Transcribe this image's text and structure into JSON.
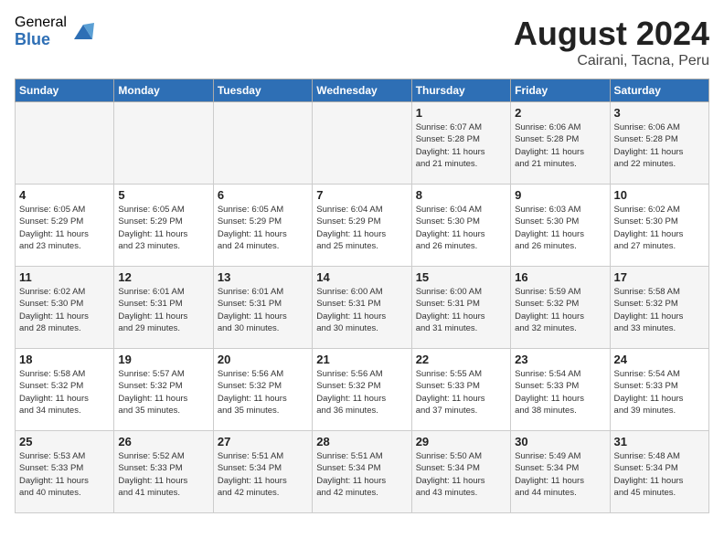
{
  "header": {
    "logo_general": "General",
    "logo_blue": "Blue",
    "month_title": "August 2024",
    "location": "Cairani, Tacna, Peru"
  },
  "weekdays": [
    "Sunday",
    "Monday",
    "Tuesday",
    "Wednesday",
    "Thursday",
    "Friday",
    "Saturday"
  ],
  "weeks": [
    [
      {
        "day": "",
        "info": ""
      },
      {
        "day": "",
        "info": ""
      },
      {
        "day": "",
        "info": ""
      },
      {
        "day": "",
        "info": ""
      },
      {
        "day": "1",
        "info": "Sunrise: 6:07 AM\nSunset: 5:28 PM\nDaylight: 11 hours\nand 21 minutes."
      },
      {
        "day": "2",
        "info": "Sunrise: 6:06 AM\nSunset: 5:28 PM\nDaylight: 11 hours\nand 21 minutes."
      },
      {
        "day": "3",
        "info": "Sunrise: 6:06 AM\nSunset: 5:28 PM\nDaylight: 11 hours\nand 22 minutes."
      }
    ],
    [
      {
        "day": "4",
        "info": "Sunrise: 6:05 AM\nSunset: 5:29 PM\nDaylight: 11 hours\nand 23 minutes."
      },
      {
        "day": "5",
        "info": "Sunrise: 6:05 AM\nSunset: 5:29 PM\nDaylight: 11 hours\nand 23 minutes."
      },
      {
        "day": "6",
        "info": "Sunrise: 6:05 AM\nSunset: 5:29 PM\nDaylight: 11 hours\nand 24 minutes."
      },
      {
        "day": "7",
        "info": "Sunrise: 6:04 AM\nSunset: 5:29 PM\nDaylight: 11 hours\nand 25 minutes."
      },
      {
        "day": "8",
        "info": "Sunrise: 6:04 AM\nSunset: 5:30 PM\nDaylight: 11 hours\nand 26 minutes."
      },
      {
        "day": "9",
        "info": "Sunrise: 6:03 AM\nSunset: 5:30 PM\nDaylight: 11 hours\nand 26 minutes."
      },
      {
        "day": "10",
        "info": "Sunrise: 6:02 AM\nSunset: 5:30 PM\nDaylight: 11 hours\nand 27 minutes."
      }
    ],
    [
      {
        "day": "11",
        "info": "Sunrise: 6:02 AM\nSunset: 5:30 PM\nDaylight: 11 hours\nand 28 minutes."
      },
      {
        "day": "12",
        "info": "Sunrise: 6:01 AM\nSunset: 5:31 PM\nDaylight: 11 hours\nand 29 minutes."
      },
      {
        "day": "13",
        "info": "Sunrise: 6:01 AM\nSunset: 5:31 PM\nDaylight: 11 hours\nand 30 minutes."
      },
      {
        "day": "14",
        "info": "Sunrise: 6:00 AM\nSunset: 5:31 PM\nDaylight: 11 hours\nand 30 minutes."
      },
      {
        "day": "15",
        "info": "Sunrise: 6:00 AM\nSunset: 5:31 PM\nDaylight: 11 hours\nand 31 minutes."
      },
      {
        "day": "16",
        "info": "Sunrise: 5:59 AM\nSunset: 5:32 PM\nDaylight: 11 hours\nand 32 minutes."
      },
      {
        "day": "17",
        "info": "Sunrise: 5:58 AM\nSunset: 5:32 PM\nDaylight: 11 hours\nand 33 minutes."
      }
    ],
    [
      {
        "day": "18",
        "info": "Sunrise: 5:58 AM\nSunset: 5:32 PM\nDaylight: 11 hours\nand 34 minutes."
      },
      {
        "day": "19",
        "info": "Sunrise: 5:57 AM\nSunset: 5:32 PM\nDaylight: 11 hours\nand 35 minutes."
      },
      {
        "day": "20",
        "info": "Sunrise: 5:56 AM\nSunset: 5:32 PM\nDaylight: 11 hours\nand 35 minutes."
      },
      {
        "day": "21",
        "info": "Sunrise: 5:56 AM\nSunset: 5:32 PM\nDaylight: 11 hours\nand 36 minutes."
      },
      {
        "day": "22",
        "info": "Sunrise: 5:55 AM\nSunset: 5:33 PM\nDaylight: 11 hours\nand 37 minutes."
      },
      {
        "day": "23",
        "info": "Sunrise: 5:54 AM\nSunset: 5:33 PM\nDaylight: 11 hours\nand 38 minutes."
      },
      {
        "day": "24",
        "info": "Sunrise: 5:54 AM\nSunset: 5:33 PM\nDaylight: 11 hours\nand 39 minutes."
      }
    ],
    [
      {
        "day": "25",
        "info": "Sunrise: 5:53 AM\nSunset: 5:33 PM\nDaylight: 11 hours\nand 40 minutes."
      },
      {
        "day": "26",
        "info": "Sunrise: 5:52 AM\nSunset: 5:33 PM\nDaylight: 11 hours\nand 41 minutes."
      },
      {
        "day": "27",
        "info": "Sunrise: 5:51 AM\nSunset: 5:34 PM\nDaylight: 11 hours\nand 42 minutes."
      },
      {
        "day": "28",
        "info": "Sunrise: 5:51 AM\nSunset: 5:34 PM\nDaylight: 11 hours\nand 42 minutes."
      },
      {
        "day": "29",
        "info": "Sunrise: 5:50 AM\nSunset: 5:34 PM\nDaylight: 11 hours\nand 43 minutes."
      },
      {
        "day": "30",
        "info": "Sunrise: 5:49 AM\nSunset: 5:34 PM\nDaylight: 11 hours\nand 44 minutes."
      },
      {
        "day": "31",
        "info": "Sunrise: 5:48 AM\nSunset: 5:34 PM\nDaylight: 11 hours\nand 45 minutes."
      }
    ]
  ]
}
